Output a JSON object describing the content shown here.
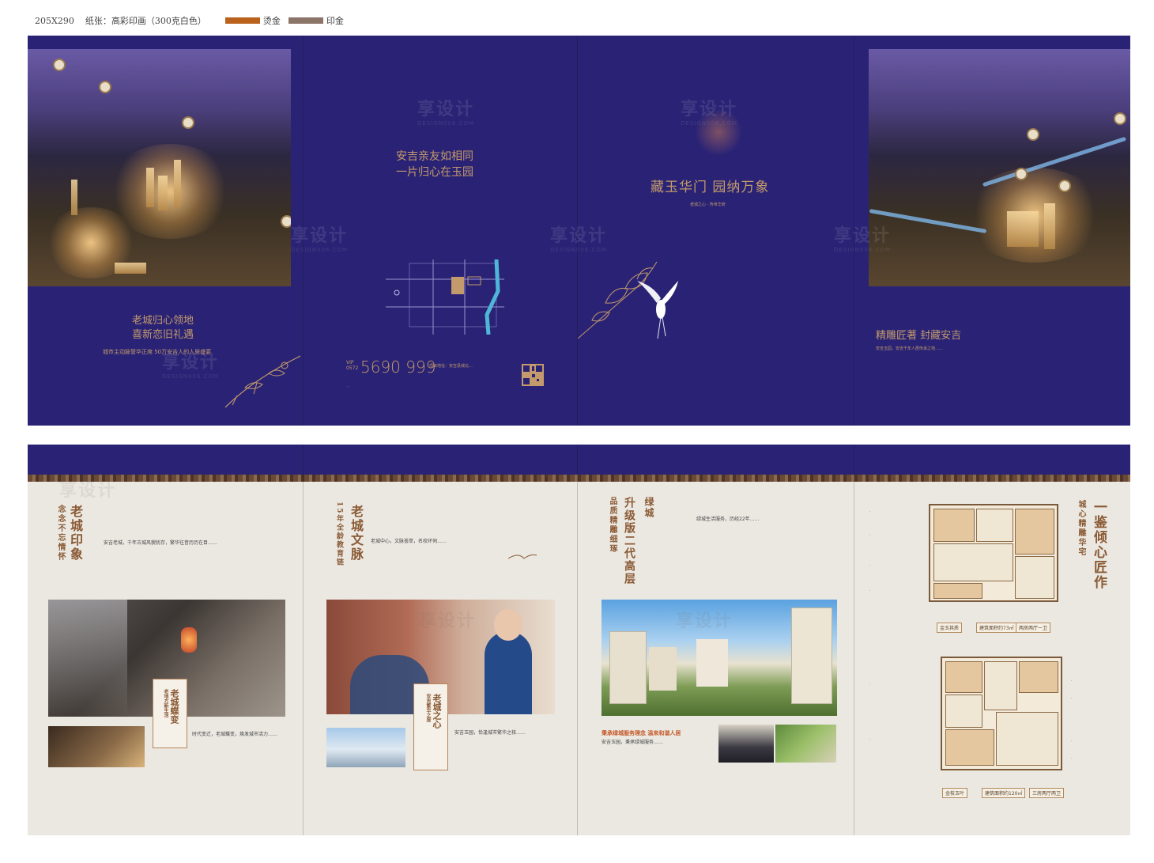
{
  "header": {
    "size": "205X290",
    "paper": "纸张：高彩印画（300克白色）",
    "legend": [
      {
        "label": "烫金",
        "color": "#b8621c"
      },
      {
        "label": "印金",
        "color": "#8b7468"
      }
    ]
  },
  "colors": {
    "navy": "#2a2375",
    "cream": "#ebe8e2",
    "gold": "#c39a6b",
    "brown": "#8a5a34"
  },
  "watermark": {
    "text": "享设计",
    "sub": "DESIGN006.COM"
  },
  "outside": {
    "panel1": {
      "headline_1": "老城归心领地",
      "headline_2": "喜新恋旧礼遇",
      "tagline": "城市主动脉誓华正席 50万安吉人的人居盛宴"
    },
    "panel2": {
      "slogan_1": "安吉亲友如相同",
      "slogan_2": "一片归心在玉园",
      "vip_label": "VIP",
      "area_code": "0572",
      "phone": "5690 999",
      "address": "项目地址：安吉县城北…",
      "disclaimer": "…"
    },
    "panel3": {
      "title": "藏玉华门 园纳万象",
      "subtitle": "老城之心 · 传世华府"
    },
    "panel4": {
      "title": "精雕匠著 封藏安吉",
      "body": "安吉玉园，安吉千年人居传承之地……"
    }
  },
  "inside": {
    "panel1": {
      "title": "老城印象",
      "sub": "念念不忘情怀",
      "body": "安吉老城，千年古城风貌犹存，繁华往昔历历在目……",
      "card_title": "老城蝶变",
      "card_sub": "老地方新生活",
      "bottom_body": "时代变迁，老城蝶变，焕发城市活力……"
    },
    "panel2": {
      "title": "老城文脉",
      "sub": "15年全龄教育链",
      "body": "老城中心，文脉荟萃，名校环伺……",
      "card_title": "老城之心",
      "card_sub": "安吉繁华之席",
      "bottom_body": "安吉玉园，恰逢城市繁华之核……"
    },
    "panel3": {
      "title_1": "绿城",
      "title_2": "升级版二代高层",
      "title_3": "品质精雕细琢",
      "body": "绿城生活服务，历经22年……",
      "service_title": "秉承绿城服务理念 温来和谐人居",
      "service_body": "安吉玉园，秉承绿城服务……"
    },
    "panel4": {
      "title": "一鉴倾心匠作",
      "sub": "城心精雕华宅",
      "plan_a_name": "金玉其质",
      "plan_a_area": "建筑面积约73㎡",
      "plan_a_type": "两房两厅一卫",
      "plan_b_name": "金枝玉叶",
      "plan_b_area": "建筑面积约120㎡",
      "plan_b_type": "三房两厅两卫"
    }
  }
}
